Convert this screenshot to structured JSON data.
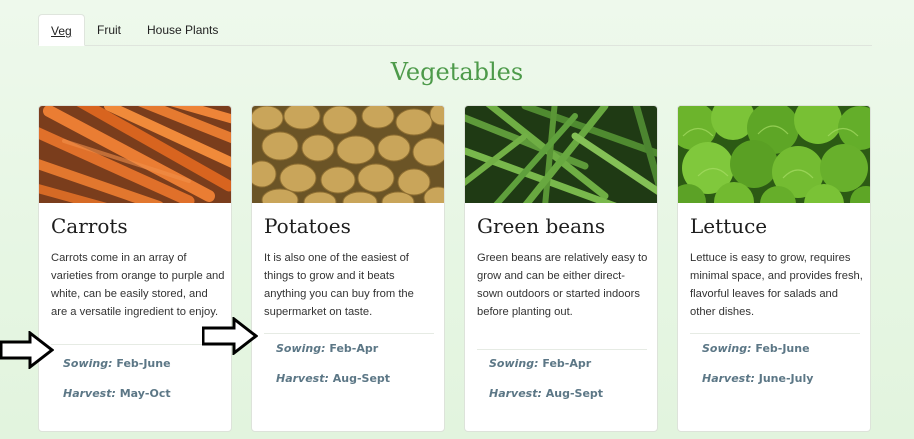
{
  "tabs": [
    {
      "label": "Veg",
      "active": true
    },
    {
      "label": "Fruit",
      "active": false
    },
    {
      "label": "House Plants",
      "active": false
    }
  ],
  "heading": "Vegetables",
  "cards": [
    {
      "title": "Carrots",
      "description": "Carrots come in an array of varieties from orange to purple and white, can be easily stored, and are a versatile ingredient to enjoy.",
      "sowing_label": "Sowing:",
      "sowing": "Feb-June",
      "harvest_label": "Harvest:",
      "harvest": "May-Oct"
    },
    {
      "title": "Potatoes",
      "description": "It is also one of the easiest of things to grow and it beats anything you can buy from the supermarket on taste.",
      "sowing_label": "Sowing:",
      "sowing": "Feb-Apr",
      "harvest_label": "Harvest:",
      "harvest": "Aug-Sept"
    },
    {
      "title": "Green beans",
      "description": "Green beans are relatively easy to grow and can be either direct-sown outdoors or started indoors before planting out.",
      "sowing_label": "Sowing:",
      "sowing": "Feb-Apr",
      "harvest_label": "Harvest:",
      "harvest": "Aug-Sept"
    },
    {
      "title": "Lettuce",
      "description": "Lettuce is easy to grow, requires minimal space, and provides fresh, flavorful leaves for salads and other dishes.",
      "sowing_label": "Sowing:",
      "sowing": "Feb-June",
      "harvest_label": "Harvest:",
      "harvest": "June-July"
    }
  ],
  "colors": {
    "heading": "#4d9a4a",
    "info_text": "#5c7786",
    "background": "#e6f6e3"
  },
  "icons": [
    "right-arrow-icon",
    "right-arrow-icon"
  ]
}
